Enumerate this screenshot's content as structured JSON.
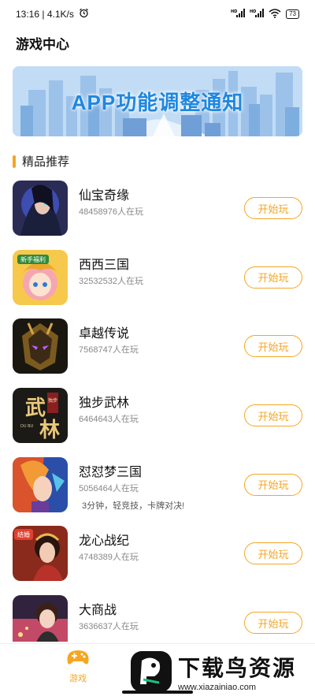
{
  "status_bar": {
    "time_speed": "13:16 | 4.1K/s",
    "battery": "73",
    "icons": [
      "alarm-icon",
      "signal-hd-icon",
      "signal-hd-icon",
      "wifi-icon",
      "battery-icon"
    ]
  },
  "header": {
    "title": "游戏中心"
  },
  "banner": {
    "text": "APP功能调整通知"
  },
  "section": {
    "title": "精品推荐"
  },
  "colors": {
    "accent": "#f5a623",
    "banner_text": "#1e87e0"
  },
  "games": [
    {
      "name": "仙宝奇缘",
      "players": "48458976人在玩",
      "desc": "",
      "button": "开始玩"
    },
    {
      "name": "西西三国",
      "players": "32532532人在玩",
      "desc": "",
      "button": "开始玩"
    },
    {
      "name": "卓越传说",
      "players": "7568747人在玩",
      "desc": "",
      "button": "开始玩"
    },
    {
      "name": "独步武林",
      "players": "6464643人在玩",
      "desc": "",
      "button": "开始玩"
    },
    {
      "name": "怼怼梦三国",
      "players": "5056464人在玩",
      "desc": "3分钟，轻竞技，卡牌对决!",
      "button": "开始玩"
    },
    {
      "name": "龙心战纪",
      "players": "4748389人在玩",
      "desc": "",
      "button": "开始玩"
    },
    {
      "name": "大商战",
      "players": "3636637人在玩",
      "desc": "",
      "button": "开始玩"
    }
  ],
  "thumb_labels": {
    "wulin_big": "武",
    "wulin_big2": "林",
    "wulin_small": "独步",
    "wulin_en": "DU BU",
    "longxin_tag": "结婚",
    "xixi_tag": "新手福利"
  },
  "bottom_nav": {
    "game_label": "游戏"
  },
  "watermark": {
    "title": "下载鸟资源",
    "url": "www.xiazainiao.com"
  }
}
